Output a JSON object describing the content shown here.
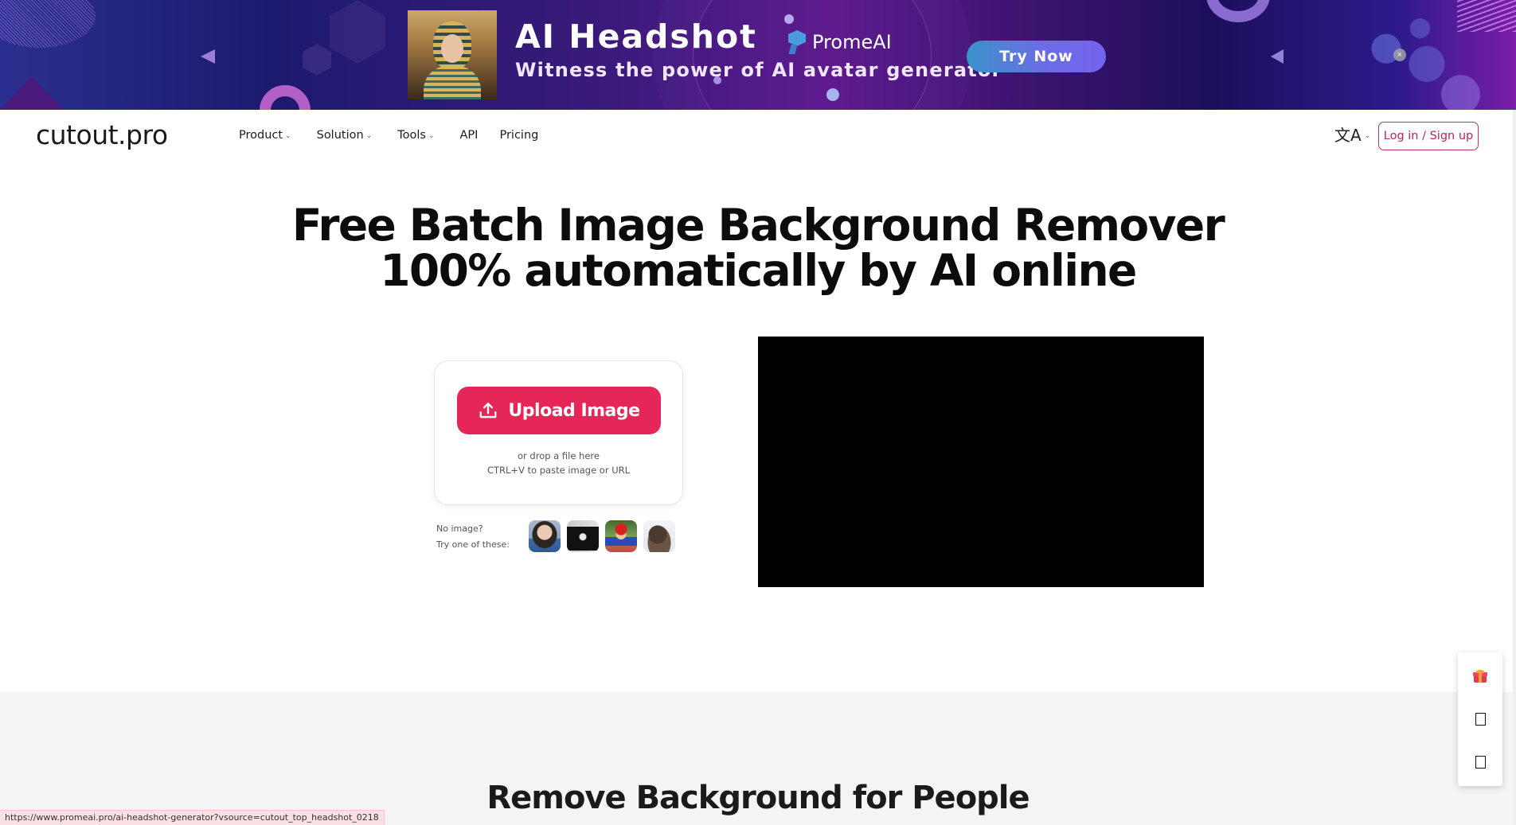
{
  "banner": {
    "headline": "AI Headshot",
    "subline": "Witness the power of AI avatar generator",
    "brand": "PromeAI",
    "cta_label": "Try Now",
    "close_label": "×",
    "colors": {
      "cta_start": "#3a92c9",
      "cta_end": "#7463ef"
    }
  },
  "header": {
    "brand": "cutout.pro",
    "nav": [
      {
        "label": "Product",
        "has_dropdown": true
      },
      {
        "label": "Solution",
        "has_dropdown": true
      },
      {
        "label": "Tools",
        "has_dropdown": true
      },
      {
        "label": "API",
        "has_dropdown": false
      },
      {
        "label": "Pricing",
        "has_dropdown": false
      }
    ],
    "chevron": "⌄",
    "language_glyph": "文A",
    "login_label": "Log in / Sign up",
    "accent_color": "#c0325e"
  },
  "hero": {
    "title_line1": "Free Batch Image Background Remover",
    "title_line2": "100% automatically by AI online"
  },
  "upload": {
    "button_label": "Upload Image",
    "drop_hint": "or drop a file here",
    "paste_hint": "CTRL+V to paste image or URL",
    "button_color": "#e62558",
    "samples_label_1": "No image?",
    "samples_label_2": "Try one of these:",
    "samples": [
      {
        "name": "girl-portrait"
      },
      {
        "name": "black-t-shirt"
      },
      {
        "name": "mario-figure"
      },
      {
        "name": "puppy"
      }
    ]
  },
  "section2": {
    "title": "Remove Background for People"
  },
  "side_toolbar": {
    "items": [
      "gift-icon",
      "square-icon",
      "square-icon"
    ]
  },
  "status_bar": {
    "url": "https://www.promeai.pro/ai-headshot-generator?vsource=cutout_top_headshot_0218"
  }
}
